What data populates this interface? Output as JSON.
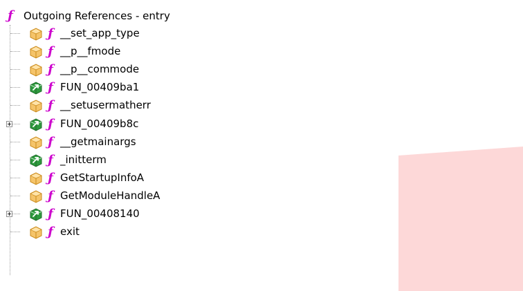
{
  "colors": {
    "function_glyph": "#cc00cc",
    "overlay_pink": "#fdd8d8",
    "external_icon": "#f5c46a",
    "thunk_icon": "#2e9a3e"
  },
  "tree": {
    "root": {
      "glyph": "ƒ",
      "label": "Outgoing References - entry"
    },
    "items": [
      {
        "glyph": "ƒ",
        "label": "__set_app_type",
        "icon": "external-function-icon",
        "expandable": false
      },
      {
        "glyph": "ƒ",
        "label": "__p__fmode",
        "icon": "external-function-icon",
        "expandable": false
      },
      {
        "glyph": "ƒ",
        "label": "__p__commode",
        "icon": "external-function-icon",
        "expandable": false
      },
      {
        "glyph": "ƒ",
        "label": "FUN_00409ba1",
        "icon": "local-function-icon",
        "expandable": false
      },
      {
        "glyph": "ƒ",
        "label": "__setusermatherr",
        "icon": "external-function-icon",
        "expandable": false
      },
      {
        "glyph": "ƒ",
        "label": "FUN_00409b8c",
        "icon": "local-function-icon",
        "expandable": true
      },
      {
        "glyph": "ƒ",
        "label": "__getmainargs",
        "icon": "external-function-icon",
        "expandable": false
      },
      {
        "glyph": "ƒ",
        "label": "_initterm",
        "icon": "local-function-icon",
        "expandable": false
      },
      {
        "glyph": "ƒ",
        "label": "GetStartupInfoA",
        "icon": "external-function-icon",
        "expandable": false
      },
      {
        "glyph": "ƒ",
        "label": "GetModuleHandleA",
        "icon": "external-function-icon",
        "expandable": false
      },
      {
        "glyph": "ƒ",
        "label": "FUN_00408140",
        "icon": "local-function-icon",
        "expandable": true
      },
      {
        "glyph": "ƒ",
        "label": "exit",
        "icon": "external-function-icon",
        "expandable": false
      }
    ]
  }
}
